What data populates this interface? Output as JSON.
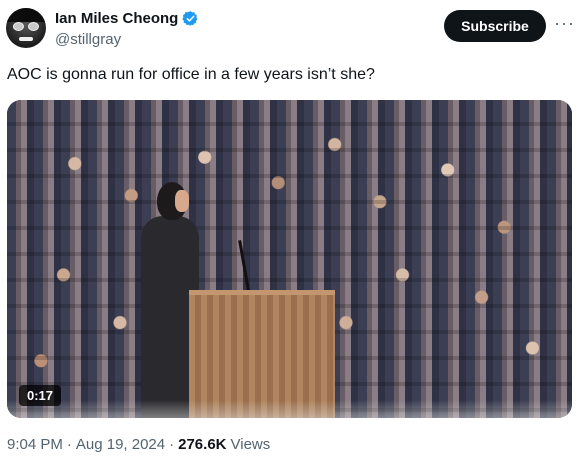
{
  "author": {
    "display_name": "Ian Miles Cheong",
    "handle": "@stillgray",
    "verified_icon": "verified-badge-icon",
    "verified_color": "#1d9bf0"
  },
  "actions": {
    "subscribe_label": "Subscribe",
    "more_icon": "more-options-icon",
    "more_glyph": "···"
  },
  "tweet": {
    "text": "AOC is gonna run for office in a few years isn’t she?"
  },
  "media": {
    "type": "video",
    "duration": "0:17"
  },
  "meta": {
    "time": "9:04 PM",
    "separator": "·",
    "date": "Aug 19, 2024",
    "views_count": "276.6K",
    "views_label": "Views"
  }
}
